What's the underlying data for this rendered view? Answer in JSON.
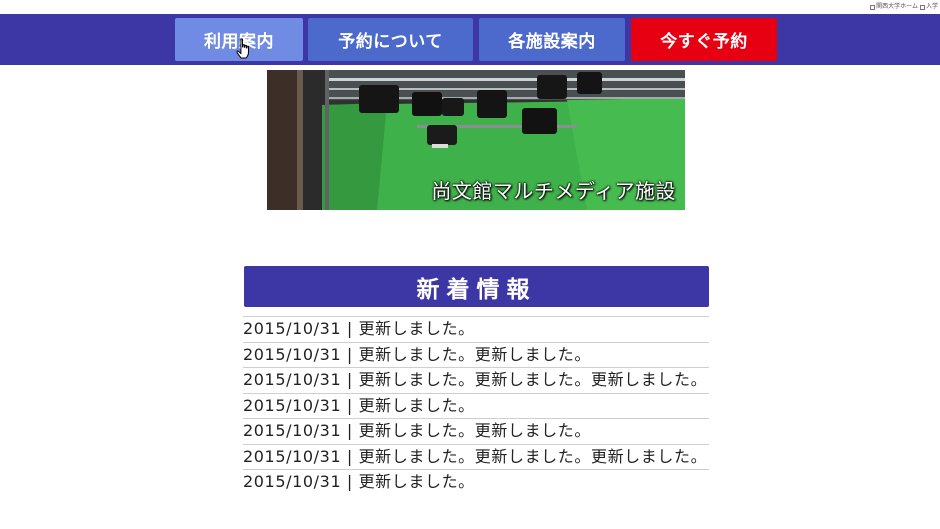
{
  "top_links": [
    "関西大学ホーム",
    "入学"
  ],
  "nav": {
    "items": [
      {
        "label": "利用案内"
      },
      {
        "label": "予約について"
      },
      {
        "label": "各施設案内"
      },
      {
        "label": "今すぐ予約"
      }
    ]
  },
  "hero": {
    "caption": "尚文館マルチメディア施設"
  },
  "news": {
    "title": "新着情報",
    "items": [
      {
        "text": "2015/10/31 | 更新しました。"
      },
      {
        "text": "2015/10/31 | 更新しました。更新しました。"
      },
      {
        "text": "2015/10/31 | 更新しました。更新しました。更新しました。"
      },
      {
        "text": "2015/10/31 | 更新しました。"
      },
      {
        "text": "2015/10/31 | 更新しました。更新しました。"
      },
      {
        "text": "2015/10/31 | 更新しました。更新しました。更新しました。"
      },
      {
        "text": "2015/10/31 | 更新しました。"
      }
    ]
  },
  "colors": {
    "navbar": "#3c37a5",
    "nav_active": "#6f8be3",
    "nav_button": "#4b6acc",
    "reserve_button": "#e60012",
    "news_header": "#3c37a5"
  },
  "icons": {
    "cursor": "hand-pointer-icon",
    "top_link": "square-bullet-icon"
  }
}
